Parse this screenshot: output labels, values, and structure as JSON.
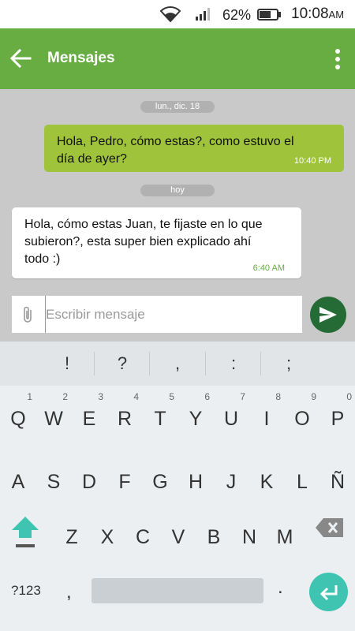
{
  "status_bar": {
    "battery_percent": "62%",
    "time": "10:08",
    "time_suffix": "AM",
    "icons": [
      "wifi-icon",
      "cell-signal-icon",
      "battery-icon"
    ]
  },
  "app_bar": {
    "title": "Mensajes",
    "icons": [
      "back-arrow-icon",
      "more-vert-icon"
    ],
    "color": "#67ad42"
  },
  "conversation": {
    "date_separators": [
      "lun., dic. 18",
      "hoy"
    ],
    "messages": [
      {
        "direction": "outgoing",
        "lines": [
          "Hola, Pedro, cómo estas?, como estuvo el",
          "día de ayer?"
        ],
        "time": "10:40 PM"
      },
      {
        "direction": "incoming",
        "lines": [
          "Hola, cómo estas Juan, te fijaste en lo que",
          "subieron?, esta super bien explicado ahí",
          "todo :)"
        ],
        "time": "6:40 AM"
      }
    ]
  },
  "composer": {
    "placeholder": "Escribir mensaje",
    "value": "",
    "icons": [
      "paperclip-icon",
      "send-icon"
    ],
    "send_color": "#256b35"
  },
  "keyboard": {
    "suggestions": [
      "!",
      "?",
      ",",
      ":",
      ";"
    ],
    "row1": [
      "Q",
      "W",
      "E",
      "R",
      "T",
      "Y",
      "U",
      "I",
      "O",
      "P"
    ],
    "row1_hints": [
      "1",
      "2",
      "3",
      "4",
      "5",
      "6",
      "7",
      "8",
      "9",
      "0"
    ],
    "row2": [
      "A",
      "S",
      "D",
      "F",
      "G",
      "H",
      "J",
      "K",
      "L",
      "Ñ"
    ],
    "row3": [
      "Z",
      "X",
      "C",
      "V",
      "B",
      "N",
      "M"
    ],
    "symbols_label": "?123",
    "comma": ",",
    "period": ".",
    "icons": [
      "shift-icon",
      "backspace-icon",
      "enter-icon"
    ],
    "shift_color": "#3fc4b2",
    "enter_color": "#3fc4b2"
  }
}
